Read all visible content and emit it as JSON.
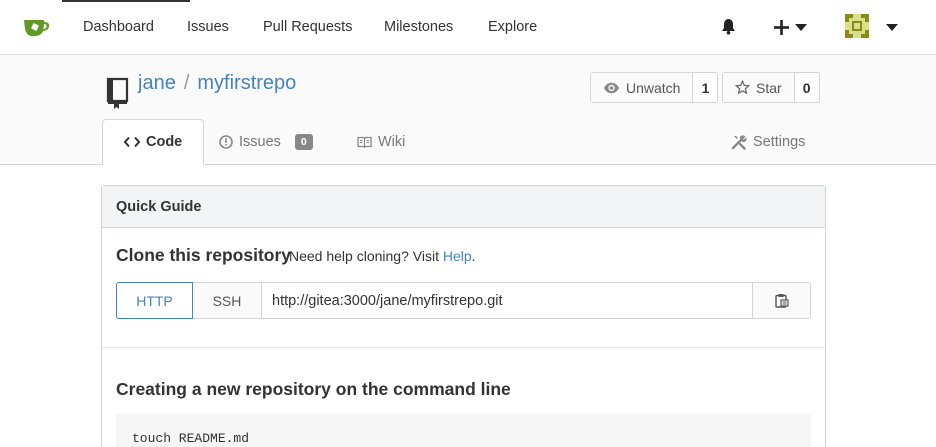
{
  "nav": {
    "items": [
      {
        "label": "Dashboard"
      },
      {
        "label": "Issues"
      },
      {
        "label": "Pull Requests"
      },
      {
        "label": "Milestones"
      },
      {
        "label": "Explore"
      }
    ],
    "plus_icon": "plus-icon",
    "bell_icon": "bell-icon"
  },
  "repo": {
    "owner": "jane",
    "separator": "/",
    "name": "myfirstrepo",
    "watch": {
      "label": "Unwatch",
      "count": "1"
    },
    "star": {
      "label": "Star",
      "count": "0"
    }
  },
  "tabs": {
    "code": "Code",
    "issues": "Issues",
    "issues_count": "0",
    "wiki": "Wiki",
    "settings": "Settings"
  },
  "guide": {
    "title": "Quick Guide",
    "clone_title": "Clone this repository",
    "clone_help_text": "Need help cloning? Visit ",
    "clone_help_link": "Help",
    "clone_help_suffix": ".",
    "http_label": "HTTP",
    "ssh_label": "SSH",
    "clone_url": "http://gitea:3000/jane/myfirstrepo.git",
    "new_repo_title": "Creating a new repository on the command line",
    "code_line_1": "touch README.md"
  },
  "colors": {
    "accent": "#4183c4",
    "logo_green": "#609926"
  }
}
